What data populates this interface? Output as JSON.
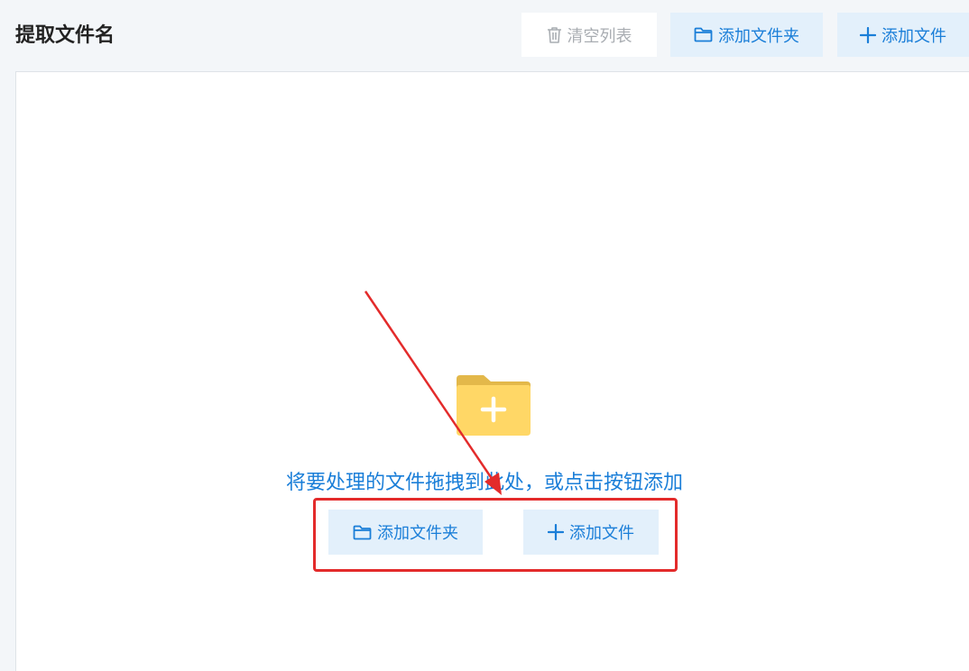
{
  "header": {
    "title": "提取文件名",
    "toolbar": {
      "clear_label": "清空列表",
      "add_folder_label": "添加文件夹",
      "add_file_label": "添加文件"
    }
  },
  "dropzone": {
    "hint": "将要处理的文件拖拽到此处，或点击按钮添加",
    "add_folder_label": "添加文件夹",
    "add_file_label": "添加文件"
  },
  "icons": {
    "clear": "trash-icon",
    "folder": "folder-icon",
    "plus": "plus-icon",
    "illustration": "folder-plus-icon"
  },
  "colors": {
    "accent": "#1a7ed8",
    "button_bg": "#e3f0fb",
    "disabled_text": "#a9adb2",
    "annotation": "#e32b2b",
    "folder_back": "#e3b84a",
    "folder_front": "#ffd766"
  }
}
